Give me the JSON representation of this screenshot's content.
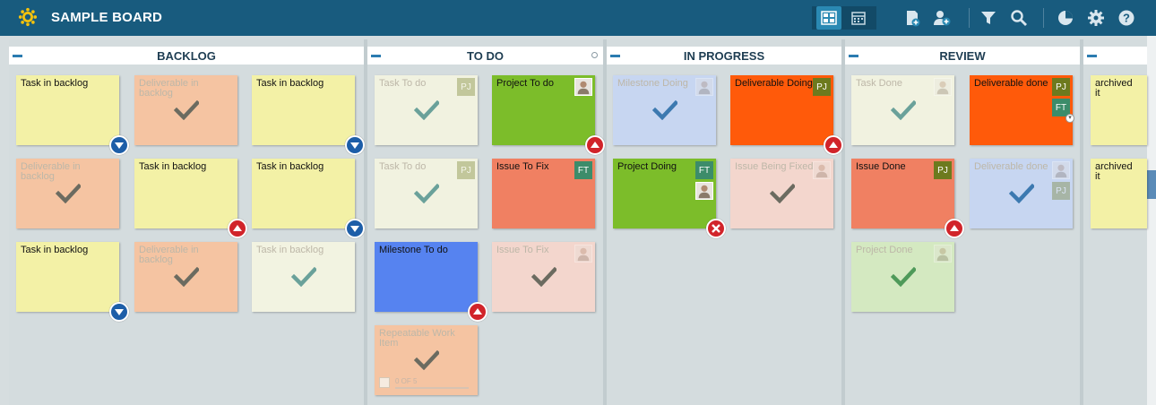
{
  "app": {
    "board_title": "SAMPLE BOARD"
  },
  "toolbar": {
    "icons": [
      "board-view-icon",
      "calendar-view-icon",
      "add-card-icon",
      "add-user-icon",
      "filter-icon",
      "search-icon",
      "analytics-icon",
      "settings-icon",
      "help-icon"
    ]
  },
  "columns": [
    {
      "title": "BACKLOG"
    },
    {
      "title": "TO DO"
    },
    {
      "title": "IN PROGRESS"
    },
    {
      "title": "REVIEW"
    },
    {
      "title": ""
    }
  ],
  "cards": [
    {
      "title": "Task in backlog",
      "color": "#f3f1a6",
      "faded": false,
      "badge": "down"
    },
    {
      "title": "Deliverable in backlog",
      "color": "#f5c4a2",
      "faded": true,
      "badge": null
    },
    {
      "title": "Task in backlog",
      "color": "#f3f1a6",
      "faded": false,
      "badge": "down"
    },
    {
      "title": "Deliverable in backlog",
      "color": "#f5c4a2",
      "faded": true,
      "badge": null
    },
    {
      "title": "Task in backlog",
      "color": "#f3f1a6",
      "faded": false,
      "badge": "up"
    },
    {
      "title": "Task in backlog",
      "color": "#f3f1a6",
      "faded": false,
      "badge": "down"
    },
    {
      "title": "Task in backlog",
      "color": "#f3f1a6",
      "faded": false,
      "badge": "down"
    },
    {
      "title": "Deliverable in backlog",
      "color": "#f5c4a2",
      "faded": true,
      "badge": null
    },
    {
      "title": "Task in backlog",
      "color": "#f2f3e1",
      "faded": true,
      "badge": null
    },
    {
      "title": "Task To do",
      "color": "#f1f2e0",
      "faded": true,
      "avatar": "PJ",
      "badge": null
    },
    {
      "title": "Project To do",
      "color": "#7cbd2a",
      "faded": false,
      "avatar": "photo",
      "badge": "up"
    },
    {
      "title": "Task To do",
      "color": "#f1f2e0",
      "faded": true,
      "avatar": "PJ",
      "badge": null
    },
    {
      "title": "Issue To Fix",
      "color": "#f08062",
      "faded": false,
      "avatar": "FT",
      "badge": null
    },
    {
      "title": "Milestone To do",
      "color": "#5683f0",
      "faded": false,
      "badge": "up"
    },
    {
      "title": "Issue To Fix",
      "color": "#f3d6cd",
      "faded": true,
      "avatar": "photo",
      "badge": null
    },
    {
      "title": "Repeatable Work Item",
      "color": "#f5c4a2",
      "faded": true,
      "badge": null,
      "progress": "0 OF 5"
    },
    {
      "title": "Milestone Doing",
      "color": "#c7d6f1",
      "faded": true,
      "avatar": "photo",
      "badge": null
    },
    {
      "title": "Deliverable Doing",
      "color": "#ff5a0a",
      "faded": false,
      "avatar": "PJ",
      "badge": "up"
    },
    {
      "title": "Project Doing",
      "color": "#7cbd2a",
      "faded": false,
      "avatar": "FT",
      "badge": "x"
    },
    {
      "title": "Issue Being Fixed",
      "color": "#f3d6cd",
      "faded": true,
      "avatar": "photo",
      "badge": null
    },
    {
      "title": "Task Done",
      "color": "#f1f2e0",
      "faded": true,
      "avatar": "photo",
      "badge": null
    },
    {
      "title": "Deliverable done",
      "color": "#ff5a0a",
      "faded": false,
      "avatar": "PJ",
      "badge": null
    },
    {
      "title": "Issue Done",
      "color": "#f08062",
      "faded": false,
      "avatar": "PJ",
      "badge": "up"
    },
    {
      "title": "Deliverable done",
      "color": "#c7d6f1",
      "faded": true,
      "avatar": "photo",
      "badge": null
    },
    {
      "title": "Project Done",
      "color": "#d4e9c1",
      "faded": true,
      "avatar": "photo",
      "badge": null
    },
    {
      "title": "archived it",
      "color": "#f3f1a6",
      "faded": false,
      "badge": null
    },
    {
      "title": "archived it",
      "color": "#f3f1a6",
      "faded": false,
      "badge": null
    }
  ],
  "extra_avatars": {
    "project_doing_second": "photo",
    "deliverable_done_second": "FT",
    "deliverable_done_faded_second": "PJ"
  }
}
